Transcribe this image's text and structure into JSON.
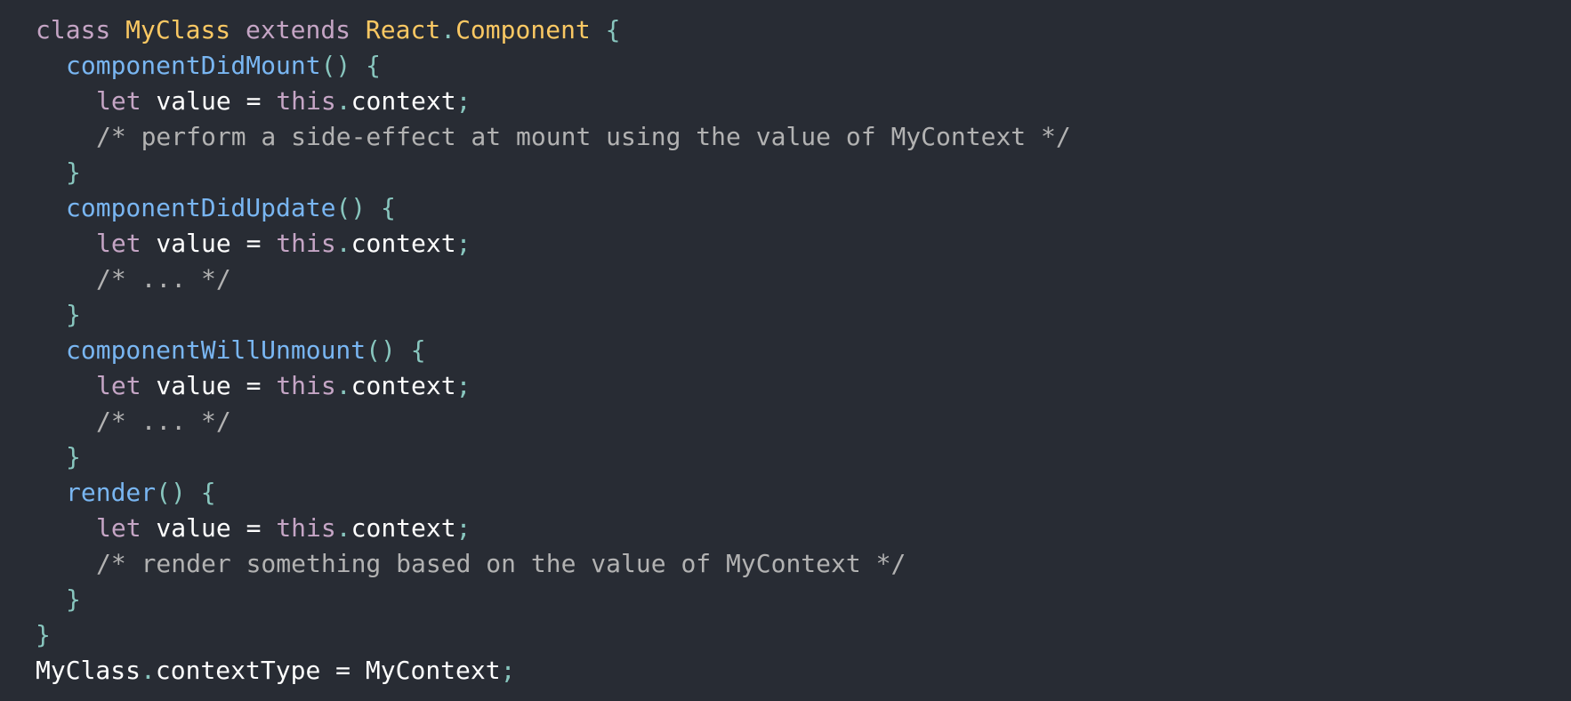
{
  "code": {
    "lines": [
      {
        "indent": 0,
        "tokens": [
          {
            "t": "class",
            "k": "kw"
          },
          {
            "t": " ",
            "k": "plain"
          },
          {
            "t": "MyClass",
            "k": "cls"
          },
          {
            "t": " ",
            "k": "plain"
          },
          {
            "t": "extends",
            "k": "kw"
          },
          {
            "t": " ",
            "k": "plain"
          },
          {
            "t": "React",
            "k": "cls"
          },
          {
            "t": ".",
            "k": "punc"
          },
          {
            "t": "Component",
            "k": "cls"
          },
          {
            "t": " ",
            "k": "plain"
          },
          {
            "t": "{",
            "k": "punc"
          }
        ]
      },
      {
        "indent": 1,
        "tokens": [
          {
            "t": "componentDidMount",
            "k": "fn"
          },
          {
            "t": "()",
            "k": "punc"
          },
          {
            "t": " ",
            "k": "plain"
          },
          {
            "t": "{",
            "k": "punc"
          }
        ]
      },
      {
        "indent": 2,
        "tokens": [
          {
            "t": "let",
            "k": "kw"
          },
          {
            "t": " value ",
            "k": "plain"
          },
          {
            "t": "=",
            "k": "op"
          },
          {
            "t": " ",
            "k": "plain"
          },
          {
            "t": "this",
            "k": "this"
          },
          {
            "t": ".",
            "k": "punc"
          },
          {
            "t": "context",
            "k": "plain"
          },
          {
            "t": ";",
            "k": "punc"
          }
        ]
      },
      {
        "indent": 2,
        "tokens": [
          {
            "t": "/* perform a side-effect at mount using the value of MyContext */",
            "k": "cmt"
          }
        ]
      },
      {
        "indent": 1,
        "tokens": [
          {
            "t": "}",
            "k": "punc"
          }
        ]
      },
      {
        "indent": 1,
        "tokens": [
          {
            "t": "componentDidUpdate",
            "k": "fn"
          },
          {
            "t": "()",
            "k": "punc"
          },
          {
            "t": " ",
            "k": "plain"
          },
          {
            "t": "{",
            "k": "punc"
          }
        ]
      },
      {
        "indent": 2,
        "tokens": [
          {
            "t": "let",
            "k": "kw"
          },
          {
            "t": " value ",
            "k": "plain"
          },
          {
            "t": "=",
            "k": "op"
          },
          {
            "t": " ",
            "k": "plain"
          },
          {
            "t": "this",
            "k": "this"
          },
          {
            "t": ".",
            "k": "punc"
          },
          {
            "t": "context",
            "k": "plain"
          },
          {
            "t": ";",
            "k": "punc"
          }
        ]
      },
      {
        "indent": 2,
        "tokens": [
          {
            "t": "/* ... */",
            "k": "cmt"
          }
        ]
      },
      {
        "indent": 1,
        "tokens": [
          {
            "t": "}",
            "k": "punc"
          }
        ]
      },
      {
        "indent": 1,
        "tokens": [
          {
            "t": "componentWillUnmount",
            "k": "fn"
          },
          {
            "t": "()",
            "k": "punc"
          },
          {
            "t": " ",
            "k": "plain"
          },
          {
            "t": "{",
            "k": "punc"
          }
        ]
      },
      {
        "indent": 2,
        "tokens": [
          {
            "t": "let",
            "k": "kw"
          },
          {
            "t": " value ",
            "k": "plain"
          },
          {
            "t": "=",
            "k": "op"
          },
          {
            "t": " ",
            "k": "plain"
          },
          {
            "t": "this",
            "k": "this"
          },
          {
            "t": ".",
            "k": "punc"
          },
          {
            "t": "context",
            "k": "plain"
          },
          {
            "t": ";",
            "k": "punc"
          }
        ]
      },
      {
        "indent": 2,
        "tokens": [
          {
            "t": "/* ... */",
            "k": "cmt"
          }
        ]
      },
      {
        "indent": 1,
        "tokens": [
          {
            "t": "}",
            "k": "punc"
          }
        ]
      },
      {
        "indent": 1,
        "tokens": [
          {
            "t": "render",
            "k": "fn"
          },
          {
            "t": "()",
            "k": "punc"
          },
          {
            "t": " ",
            "k": "plain"
          },
          {
            "t": "{",
            "k": "punc"
          }
        ]
      },
      {
        "indent": 2,
        "tokens": [
          {
            "t": "let",
            "k": "kw"
          },
          {
            "t": " value ",
            "k": "plain"
          },
          {
            "t": "=",
            "k": "op"
          },
          {
            "t": " ",
            "k": "plain"
          },
          {
            "t": "this",
            "k": "this"
          },
          {
            "t": ".",
            "k": "punc"
          },
          {
            "t": "context",
            "k": "plain"
          },
          {
            "t": ";",
            "k": "punc"
          }
        ]
      },
      {
        "indent": 2,
        "tokens": [
          {
            "t": "/* render something based on the value of MyContext */",
            "k": "cmt"
          }
        ]
      },
      {
        "indent": 1,
        "tokens": [
          {
            "t": "}",
            "k": "punc"
          }
        ]
      },
      {
        "indent": 0,
        "tokens": [
          {
            "t": "}",
            "k": "punc"
          }
        ]
      },
      {
        "indent": 0,
        "tokens": [
          {
            "t": "MyClass",
            "k": "plain"
          },
          {
            "t": ".",
            "k": "punc"
          },
          {
            "t": "contextType ",
            "k": "plain"
          },
          {
            "t": "=",
            "k": "op"
          },
          {
            "t": " MyContext",
            "k": "plain"
          },
          {
            "t": ";",
            "k": "punc"
          }
        ]
      }
    ]
  },
  "theme": {
    "background": "#282c34",
    "keyword": "#c5a5c5",
    "class_name": "#fac863",
    "function": "#79b6f2",
    "punctuation": "#88c6be",
    "plain": "#ffffff",
    "comment": "#b2b2b2"
  }
}
